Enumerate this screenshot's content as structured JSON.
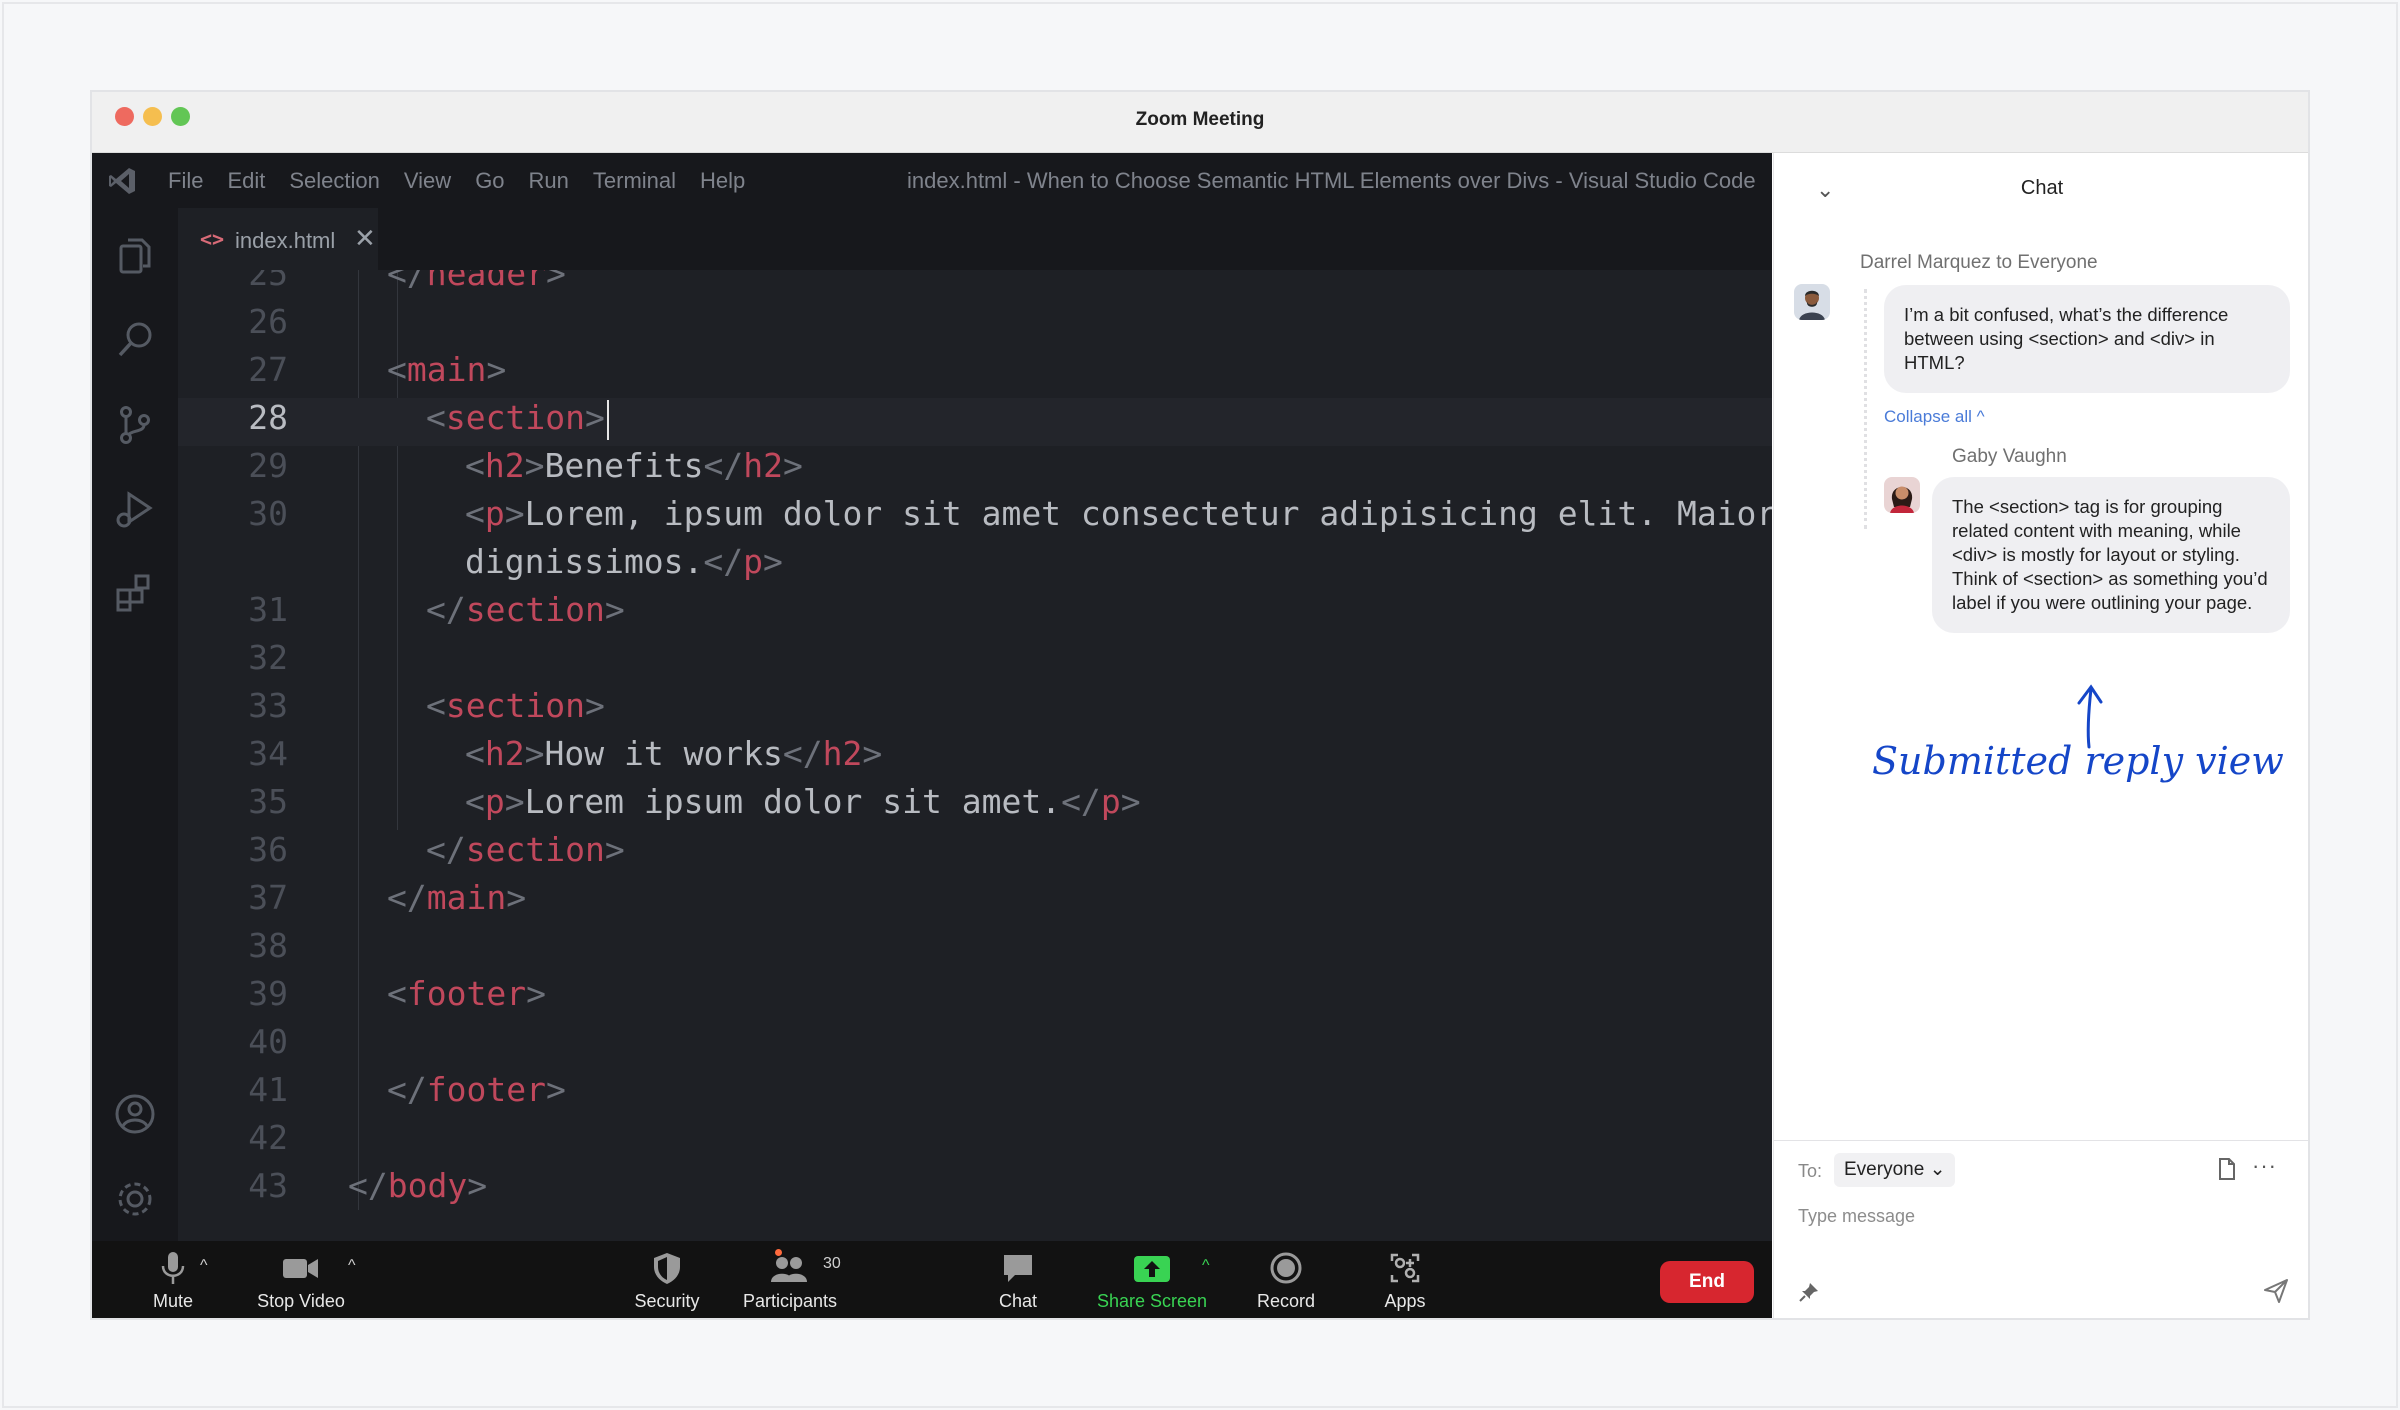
{
  "window": {
    "title": "Zoom Meeting"
  },
  "vscode": {
    "menu": [
      "File",
      "Edit",
      "Selection",
      "View",
      "Go",
      "Run",
      "Terminal",
      "Help"
    ],
    "title": "index.html - When to Choose Semantic HTML Elements over Divs - Visual Studio Code",
    "tab": {
      "icon": "<>",
      "label": "index.html",
      "close": "✕"
    },
    "current_line": "28",
    "lines": [
      {
        "n": "25",
        "tokens": [
          [
            "br",
            "</"
          ],
          [
            "tag",
            "header"
          ],
          [
            "br",
            ">"
          ]
        ],
        "indent": 1
      },
      {
        "n": "26",
        "tokens": [],
        "indent": 0
      },
      {
        "n": "27",
        "tokens": [
          [
            "br",
            "<"
          ],
          [
            "tag",
            "main"
          ],
          [
            "br",
            ">"
          ]
        ],
        "indent": 1
      },
      {
        "n": "28",
        "tokens": [
          [
            "br",
            "<"
          ],
          [
            "tag",
            "section"
          ],
          [
            "br",
            ">"
          ]
        ],
        "indent": 2
      },
      {
        "n": "29",
        "tokens": [
          [
            "br",
            "<"
          ],
          [
            "tag",
            "h2"
          ],
          [
            "br",
            ">"
          ],
          [
            "txt",
            "Benefits"
          ],
          [
            "br",
            "</"
          ],
          [
            "tag",
            "h2"
          ],
          [
            "br",
            ">"
          ]
        ],
        "indent": 3
      },
      {
        "n": "30",
        "tokens": [
          [
            "br",
            "<"
          ],
          [
            "tag",
            "p"
          ],
          [
            "br",
            ">"
          ],
          [
            "txt",
            "Lorem, ipsum dolor sit amet consectetur adipisicing elit. Maiores"
          ]
        ],
        "indent": 3
      },
      {
        "n": "",
        "tokens": [
          [
            "txt",
            "dignissimos."
          ],
          [
            "br",
            "</"
          ],
          [
            "tag",
            "p"
          ],
          [
            "br",
            ">"
          ]
        ],
        "indent": 3
      },
      {
        "n": "31",
        "tokens": [
          [
            "br",
            "</"
          ],
          [
            "tag",
            "section"
          ],
          [
            "br",
            ">"
          ]
        ],
        "indent": 2
      },
      {
        "n": "32",
        "tokens": [],
        "indent": 0
      },
      {
        "n": "33",
        "tokens": [
          [
            "br",
            "<"
          ],
          [
            "tag",
            "section"
          ],
          [
            "br",
            ">"
          ]
        ],
        "indent": 2
      },
      {
        "n": "34",
        "tokens": [
          [
            "br",
            "<"
          ],
          [
            "tag",
            "h2"
          ],
          [
            "br",
            ">"
          ],
          [
            "txt",
            "How it works"
          ],
          [
            "br",
            "</"
          ],
          [
            "tag",
            "h2"
          ],
          [
            "br",
            ">"
          ]
        ],
        "indent": 3
      },
      {
        "n": "35",
        "tokens": [
          [
            "br",
            "<"
          ],
          [
            "tag",
            "p"
          ],
          [
            "br",
            ">"
          ],
          [
            "txt",
            "Lorem ipsum dolor sit amet."
          ],
          [
            "br",
            "</"
          ],
          [
            "tag",
            "p"
          ],
          [
            "br",
            ">"
          ]
        ],
        "indent": 3
      },
      {
        "n": "36",
        "tokens": [
          [
            "br",
            "</"
          ],
          [
            "tag",
            "section"
          ],
          [
            "br",
            ">"
          ]
        ],
        "indent": 2
      },
      {
        "n": "37",
        "tokens": [
          [
            "br",
            "</"
          ],
          [
            "tag",
            "main"
          ],
          [
            "br",
            ">"
          ]
        ],
        "indent": 1
      },
      {
        "n": "38",
        "tokens": [],
        "indent": 0
      },
      {
        "n": "39",
        "tokens": [
          [
            "br",
            "<"
          ],
          [
            "tag",
            "footer"
          ],
          [
            "br",
            ">"
          ]
        ],
        "indent": 1
      },
      {
        "n": "40",
        "tokens": [],
        "indent": 0
      },
      {
        "n": "41",
        "tokens": [
          [
            "br",
            "</"
          ],
          [
            "tag",
            "footer"
          ],
          [
            "br",
            ">"
          ]
        ],
        "indent": 1
      },
      {
        "n": "42",
        "tokens": [],
        "indent": 0
      },
      {
        "n": "43",
        "tokens": [
          [
            "br",
            "</"
          ],
          [
            "tag",
            "body"
          ],
          [
            "br",
            ">"
          ]
        ],
        "indent": 0
      }
    ],
    "activity_icons": [
      "files-icon",
      "search-icon",
      "source-control-icon",
      "run-debug-icon",
      "extensions-icon",
      "account-icon",
      "settings-icon"
    ]
  },
  "toolbar": {
    "mute": "Mute",
    "stop_video": "Stop Video",
    "security": "Security",
    "participants": "Participants",
    "participants_count": "30",
    "chat": "Chat",
    "share_screen": "Share Screen",
    "record": "Record",
    "apps": "Apps",
    "end": "End",
    "colors": {
      "share": "#39d353",
      "end": "#d7262f"
    }
  },
  "chat": {
    "title": "Chat",
    "message1": {
      "header": "Darrel Marquez to Everyone",
      "text": "I’m a bit confused, what’s the difference between using <section> and <div> in HTML?"
    },
    "collapse_all": "Collapse all",
    "reply": {
      "sender": "Gaby Vaughn",
      "text": "The <section> tag is for grouping related content with meaning, while <div> is mostly for layout or styling. Think of <section> as something you’d label if you were outlining your page."
    },
    "annotation": "Submitted reply view",
    "to_label": "To:",
    "to_value": "Everyone",
    "placeholder": "Type message"
  }
}
